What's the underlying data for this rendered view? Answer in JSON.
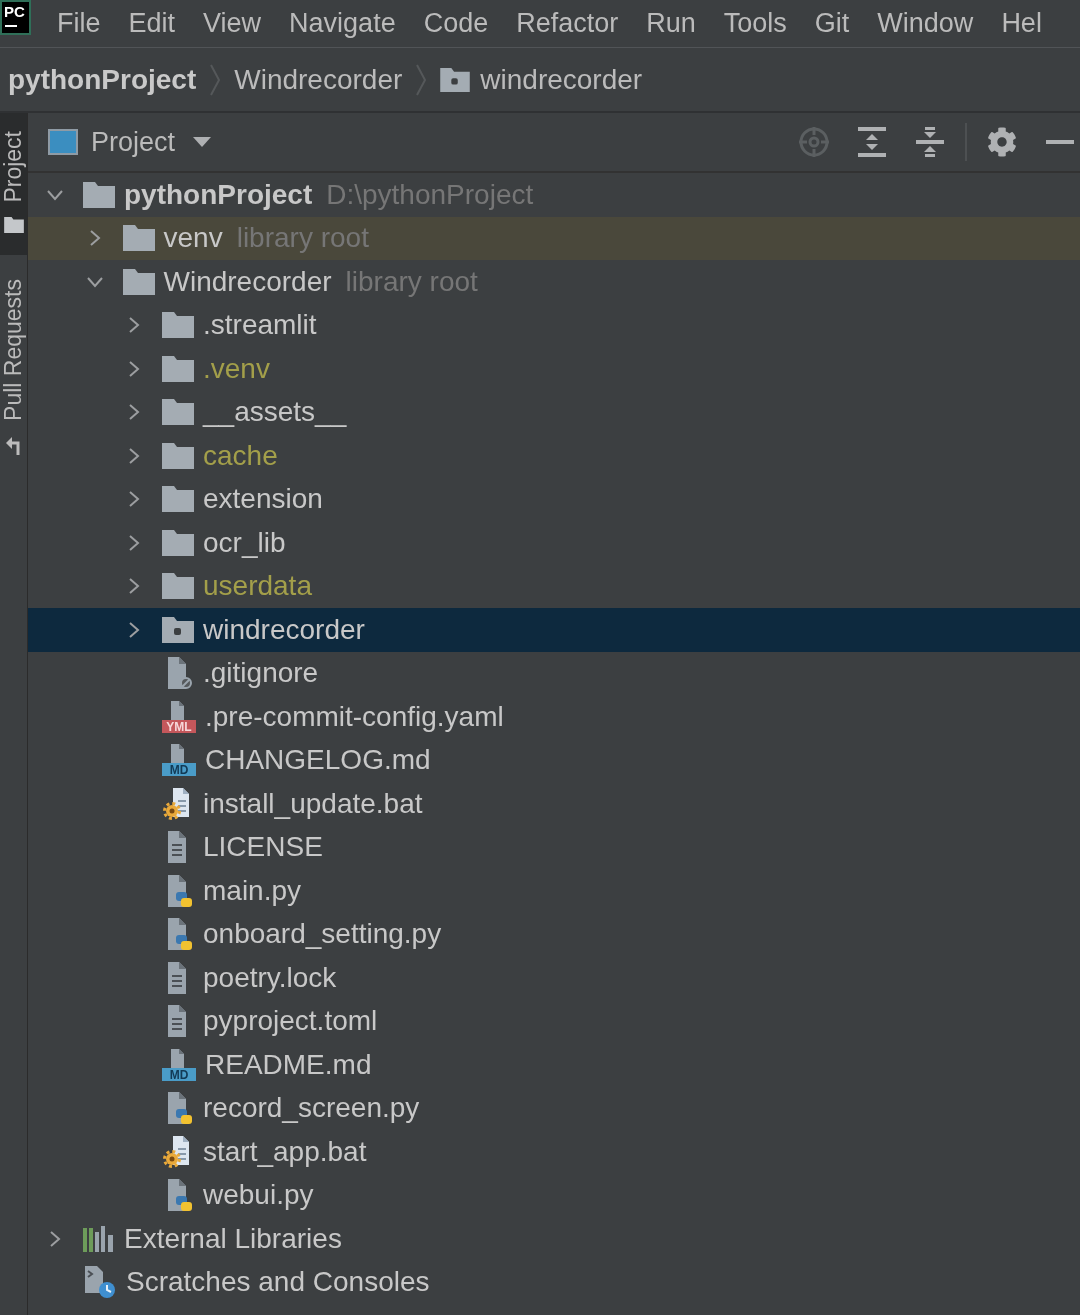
{
  "logo": "PC",
  "menu": [
    "File",
    "Edit",
    "View",
    "Navigate",
    "Code",
    "Refactor",
    "Run",
    "Tools",
    "Git",
    "Window",
    "Hel"
  ],
  "breadcrumbs": [
    {
      "label": "pythonProject",
      "kind": "project"
    },
    {
      "label": "Windrecorder",
      "kind": "module"
    },
    {
      "label": "windrecorder",
      "kind": "package"
    }
  ],
  "tool_strip": [
    {
      "label": "Project",
      "kind": "project",
      "selected": true
    },
    {
      "label": "Pull Requests",
      "kind": "pull-requests",
      "selected": false
    }
  ],
  "panel": {
    "title": "Project",
    "toolbar": [
      {
        "kind": "locate",
        "disabled": true
      },
      {
        "kind": "expand-all",
        "disabled": false
      },
      {
        "kind": "collapse-all",
        "disabled": false
      },
      {
        "kind": "settings",
        "disabled": false
      },
      {
        "kind": "hide",
        "disabled": false
      }
    ]
  },
  "tree": [
    {
      "name": "pythonProject",
      "kind": "project",
      "note": "D:\\pythonProject",
      "expanded": true,
      "selected": false,
      "highlighted": false,
      "ignored": false,
      "children": [
        {
          "name": "venv",
          "kind": "folder",
          "note": "library root",
          "expanded": false,
          "selected": false,
          "highlighted": true,
          "ignored": false
        },
        {
          "name": "Windrecorder",
          "kind": "folder",
          "note": "library root",
          "expanded": true,
          "selected": false,
          "highlighted": false,
          "ignored": false,
          "children": [
            {
              "name": ".streamlit",
              "kind": "folder",
              "expanded": false,
              "selected": false,
              "highlighted": false,
              "ignored": false
            },
            {
              "name": ".venv",
              "kind": "folder",
              "expanded": false,
              "selected": false,
              "highlighted": false,
              "ignored": true
            },
            {
              "name": "__assets__",
              "kind": "folder",
              "expanded": false,
              "selected": false,
              "highlighted": false,
              "ignored": false
            },
            {
              "name": "cache",
              "kind": "folder",
              "expanded": false,
              "selected": false,
              "highlighted": false,
              "ignored": true
            },
            {
              "name": "extension",
              "kind": "folder",
              "expanded": false,
              "selected": false,
              "highlighted": false,
              "ignored": false
            },
            {
              "name": "ocr_lib",
              "kind": "folder",
              "expanded": false,
              "selected": false,
              "highlighted": false,
              "ignored": false
            },
            {
              "name": "userdata",
              "kind": "folder",
              "expanded": false,
              "selected": false,
              "highlighted": false,
              "ignored": true
            },
            {
              "name": "windrecorder",
              "kind": "package",
              "expanded": false,
              "selected": true,
              "highlighted": false,
              "ignored": false
            },
            {
              "name": ".gitignore",
              "kind": "gitignore",
              "selected": false,
              "highlighted": false,
              "ignored": false
            },
            {
              "name": ".pre-commit-config.yaml",
              "kind": "yaml",
              "icon_label": "YML",
              "selected": false,
              "highlighted": false,
              "ignored": false
            },
            {
              "name": "CHANGELOG.md",
              "kind": "markdown",
              "icon_label": "MD",
              "selected": false,
              "highlighted": false,
              "ignored": false
            },
            {
              "name": "install_update.bat",
              "kind": "batch",
              "selected": false,
              "highlighted": false,
              "ignored": false
            },
            {
              "name": "LICENSE",
              "kind": "text",
              "selected": false,
              "highlighted": false,
              "ignored": false
            },
            {
              "name": "main.py",
              "kind": "python",
              "selected": false,
              "highlighted": false,
              "ignored": false
            },
            {
              "name": "onboard_setting.py",
              "kind": "python",
              "selected": false,
              "highlighted": false,
              "ignored": false
            },
            {
              "name": "poetry.lock",
              "kind": "text",
              "selected": false,
              "highlighted": false,
              "ignored": false
            },
            {
              "name": "pyproject.toml",
              "kind": "text",
              "selected": false,
              "highlighted": false,
              "ignored": false
            },
            {
              "name": "README.md",
              "kind": "markdown",
              "icon_label": "MD",
              "selected": false,
              "highlighted": false,
              "ignored": false
            },
            {
              "name": "record_screen.py",
              "kind": "python",
              "selected": false,
              "highlighted": false,
              "ignored": false
            },
            {
              "name": "start_app.bat",
              "kind": "batch",
              "selected": false,
              "highlighted": false,
              "ignored": false
            },
            {
              "name": "webui.py",
              "kind": "python",
              "selected": false,
              "highlighted": false,
              "ignored": false
            }
          ]
        }
      ]
    },
    {
      "name": "External Libraries",
      "kind": "libraries",
      "expanded": false,
      "selected": false,
      "highlighted": false,
      "ignored": false
    },
    {
      "name": "Scratches and Consoles",
      "kind": "scratches",
      "selected": false,
      "highlighted": false,
      "ignored": false
    }
  ]
}
